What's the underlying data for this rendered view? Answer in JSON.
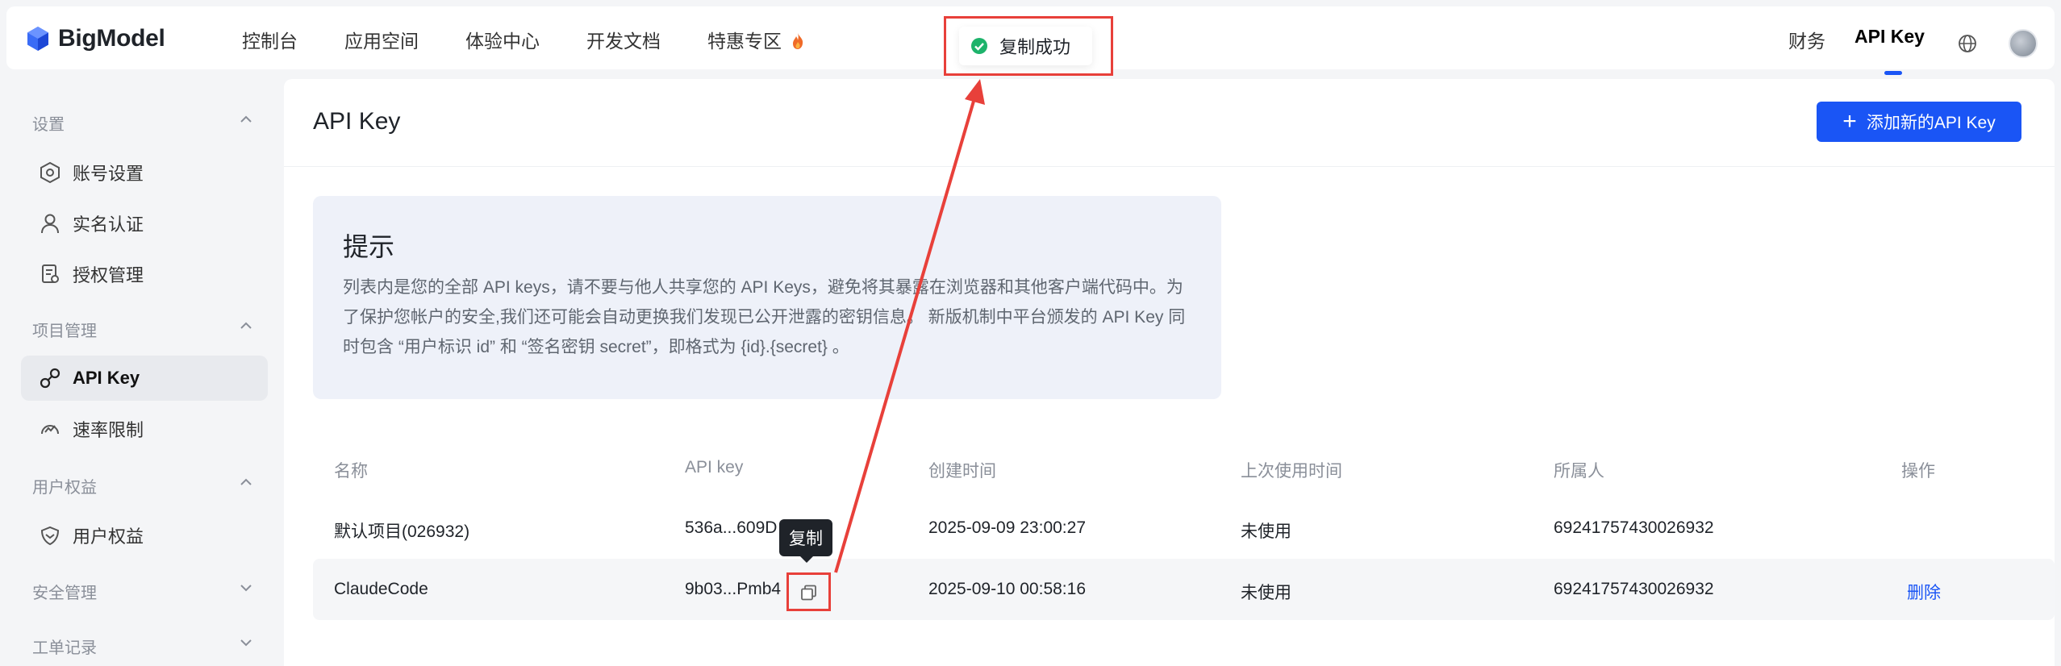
{
  "app": {
    "logo_text": "BigModel"
  },
  "nav": {
    "items": [
      "控制台",
      "应用空间",
      "体验中心",
      "开发文档",
      "特惠专区"
    ],
    "finance": "财务",
    "api_key": "API Key",
    "hot_icon": "fire-icon"
  },
  "toast": {
    "text": "复制成功",
    "icon": "success-check-icon",
    "color": "#1db36b"
  },
  "sidebar": {
    "groups": [
      {
        "label": "设置",
        "items": [
          "账号设置",
          "实名认证",
          "授权管理"
        ]
      },
      {
        "label": "项目管理",
        "items": [
          "API Key",
          "速率限制"
        ]
      },
      {
        "label": "用户权益",
        "items": [
          "用户权益"
        ]
      },
      {
        "label": "安全管理",
        "items": []
      },
      {
        "label": "工单记录",
        "items": []
      }
    ],
    "active_item": "API Key"
  },
  "page": {
    "title": "API Key",
    "add_button": "添加新的API Key"
  },
  "tip": {
    "title": "提示",
    "body": "列表内是您的全部 API keys，请不要与他人共享您的 API Keys，避免将其暴露在浏览器和其他客户端代码中。为了保护您帐户的安全,我们还可能会自动更换我们发现已公开泄露的密钥信息。 新版机制中平台颁发的 API Key 同时包含 “用户标识 id” 和 “签名密钥 secret”，即格式为 {id}.{secret} 。"
  },
  "table": {
    "headers": [
      "名称",
      "API key",
      "创建时间",
      "上次使用时间",
      "所属人",
      "操作"
    ],
    "rows": [
      {
        "name": "默认项目(026932)",
        "api_key": "536a...609D",
        "created": "2025-09-09 23:00:27",
        "last_used": "未使用",
        "owner": "69241757430026932",
        "action": ""
      },
      {
        "name": "ClaudeCode",
        "api_key": "9b03...Pmb4",
        "created": "2025-09-10 00:58:16",
        "last_used": "未使用",
        "owner": "69241757430026932",
        "action": "删除"
      }
    ]
  },
  "tooltip": {
    "text": "复制"
  },
  "colors": {
    "accent": "#1a55f5",
    "highlight": "#e8403a"
  }
}
